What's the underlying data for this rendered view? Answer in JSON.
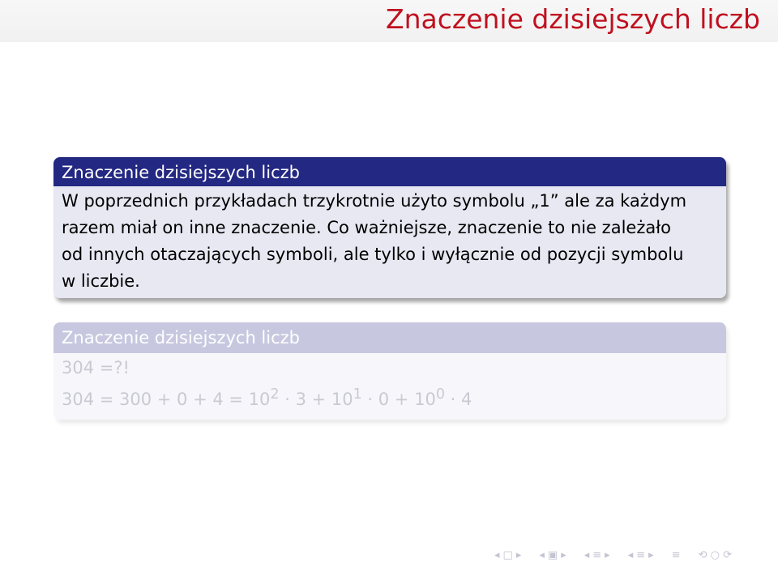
{
  "frame": {
    "title": "Znaczenie dzisiejszych liczb"
  },
  "blocks": [
    {
      "title": "Znaczenie dzisiejszych liczb",
      "body_lines": [
        "W poprzednich przykładach trzykrotnie użyto symbolu „1” ale za każdym",
        "razem miał on inne znaczenie. Co ważniejsze, znaczenie to nie zależało",
        "od innych otaczających symboli, ale tylko i wyłącznie od pozycji symbolu",
        "w liczbie."
      ]
    },
    {
      "title": "Znaczenie dzisiejszych liczb",
      "line1": "304 =?!",
      "line2": {
        "prefix": "304 = 300 + 0 + 4 = 10",
        "exp1": "2",
        "mid1": " · 3 + 10",
        "exp2": "1",
        "mid2": " · 0 + 10",
        "exp3": "0",
        "suffix": " · 4"
      }
    }
  ],
  "nav_icons": [
    "arrow-left-icon",
    "frame-icon",
    "arrow-right-icon",
    "arrow-left-icon",
    "subsection-icon",
    "arrow-right-icon",
    "arrow-left-icon",
    "section-icon",
    "arrow-right-icon",
    "arrow-left-icon",
    "presentation-icon",
    "arrow-right-icon",
    "align-icon",
    "zoom-icon"
  ]
}
